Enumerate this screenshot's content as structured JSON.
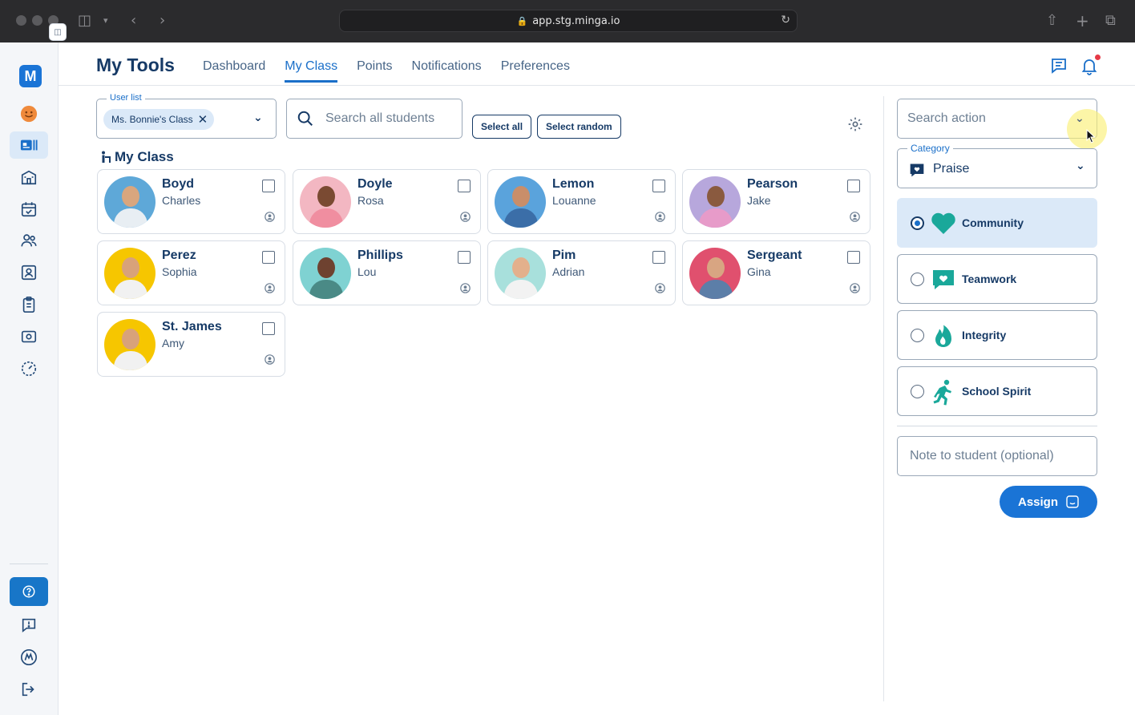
{
  "browser": {
    "url": "app.stg.minga.io"
  },
  "rail": {
    "logo": "M"
  },
  "header": {
    "title": "My Tools",
    "tabs": [
      {
        "label": "Dashboard"
      },
      {
        "label": "My Class"
      },
      {
        "label": "Points"
      },
      {
        "label": "Notifications"
      },
      {
        "label": "Preferences"
      }
    ],
    "active_tab": "My Class"
  },
  "filters": {
    "userlist_label": "User list",
    "userlist_chip": "Ms. Bonnie's Class",
    "search_placeholder": "Search all students",
    "select_all": "Select all",
    "select_random": "Select random"
  },
  "section_title": "My Class",
  "students": [
    {
      "last": "Boyd",
      "first": "Charles",
      "skin": "#d9a67e",
      "shirt": "#e8eef3",
      "bg": "#5ea8d8"
    },
    {
      "last": "Doyle",
      "first": "Rosa",
      "skin": "#7a4a32",
      "shirt": "#f08ea0",
      "bg": "#f3b7c2"
    },
    {
      "last": "Lemon",
      "first": "Louanne",
      "skin": "#c98e6a",
      "shirt": "#3b6ea8",
      "bg": "#5aa3dc"
    },
    {
      "last": "Pearson",
      "first": "Jake",
      "skin": "#8a5a3f",
      "shirt": "#e79bc9",
      "bg": "#b7a7dc"
    },
    {
      "last": "Perez",
      "first": "Sophia",
      "skin": "#d8a27a",
      "shirt": "#f1f1f1",
      "bg": "#f6c600"
    },
    {
      "last": "Phillips",
      "first": "Lou",
      "skin": "#6e4230",
      "shirt": "#4a8a86",
      "bg": "#7fd2d2"
    },
    {
      "last": "Pim",
      "first": "Adrian",
      "skin": "#e3b08c",
      "shirt": "#f2f2f2",
      "bg": "#a8e0dc"
    },
    {
      "last": "Sergeant",
      "first": "Gina",
      "skin": "#d8a582",
      "shirt": "#5c7ea8",
      "bg": "#e0506e"
    },
    {
      "last": "St. James",
      "first": "Amy",
      "skin": "#d8a27a",
      "shirt": "#f1f1f1",
      "bg": "#f6c600"
    }
  ],
  "panel": {
    "action_placeholder": "Search action",
    "category_label": "Category",
    "category_value": "Praise",
    "options": [
      {
        "label": "Community",
        "icon": "heart-icon",
        "selected": true
      },
      {
        "label": "Teamwork",
        "icon": "chat-heart-icon",
        "selected": false
      },
      {
        "label": "Integrity",
        "icon": "flame-icon",
        "selected": false
      },
      {
        "label": "School Spirit",
        "icon": "running-person-icon",
        "selected": false
      }
    ],
    "note_placeholder": "Note to student (optional)",
    "assign": "Assign"
  },
  "colors": {
    "primary": "#1a74d6",
    "navy": "#163a66",
    "teal": "#1aa89a",
    "selected_bg": "#dbe9f8"
  }
}
